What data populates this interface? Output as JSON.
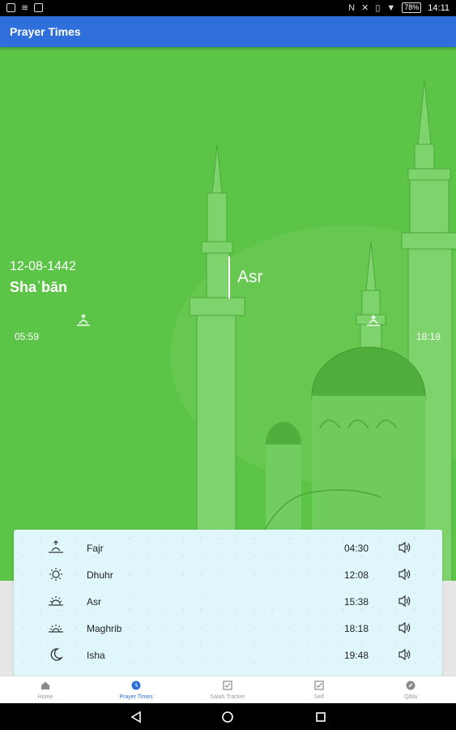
{
  "status_bar": {
    "time": "14:11",
    "battery": "78%"
  },
  "app_bar": {
    "title": "Prayer Times"
  },
  "hero": {
    "hijri_date": "12-08-1442",
    "hijri_month": "Shaʿbān",
    "current_prayer": "Asr",
    "start_time": "05:59",
    "end_time": "18:18"
  },
  "prayers": [
    {
      "name": "Fajr",
      "time": "04:30",
      "icon": "sunrise-icon"
    },
    {
      "name": "Dhuhr",
      "time": "12:08",
      "icon": "sun-icon"
    },
    {
      "name": "Asr",
      "time": "15:38",
      "icon": "sun-low-icon"
    },
    {
      "name": "Maghrib",
      "time": "18:18",
      "icon": "sunset-icon"
    },
    {
      "name": "Isha",
      "time": "19:48",
      "icon": "moon-icon"
    }
  ],
  "bottom_nav": [
    {
      "label": "Home",
      "icon": "home-icon",
      "active": false
    },
    {
      "label": "Prayer Times",
      "icon": "clock-icon",
      "active": true
    },
    {
      "label": "Salah Tracker",
      "icon": "check-square-icon",
      "active": false
    },
    {
      "label": "Self",
      "icon": "check-square-icon",
      "active": false
    },
    {
      "label": "Qibla",
      "icon": "compass-icon",
      "active": false
    }
  ],
  "colors": {
    "app_bar": "#2f6fdb",
    "hero_green": "#5ec64b",
    "card_bg": "#dff6fb",
    "active_nav": "#2f6fdb"
  }
}
